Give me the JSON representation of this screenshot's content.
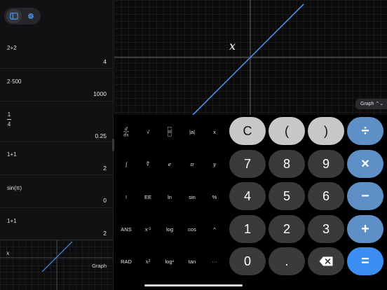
{
  "sidebar": {
    "history": [
      {
        "expr": "2+2",
        "result": "4"
      },
      {
        "expr": "2·500",
        "result": "1000"
      },
      {
        "num": "1",
        "den": "4",
        "result": "0.25"
      },
      {
        "expr": "1+1",
        "result": "2"
      },
      {
        "expr": "sin(π)",
        "result": "0"
      },
      {
        "expr": "1+1",
        "result": "2"
      }
    ],
    "mini_graph": {
      "var": "x",
      "label": "Graph"
    }
  },
  "graph": {
    "var": "x",
    "mode": "Graph ⌃⌄",
    "line_color": "#4a8fe8"
  },
  "scientific": {
    "r0": [
      "d/dx",
      "√",
      "⊡",
      "|a|",
      "x"
    ],
    "r1": [
      "∫",
      "∛",
      "e",
      "π",
      "y"
    ],
    "r2": [
      "!",
      "EE",
      "ln",
      "sin",
      "%"
    ],
    "r3": [
      "ANS",
      "x",
      "-1",
      "log",
      "cos",
      "^"
    ],
    "r4": [
      "RAD",
      "x",
      "2",
      "log",
      "a",
      "tan",
      "···"
    ]
  },
  "keypad": {
    "clear": "C",
    "paren_open": "(",
    "paren_close": ")",
    "divide": "÷",
    "seven": "7",
    "eight": "8",
    "nine": "9",
    "multiply": "×",
    "four": "4",
    "five": "5",
    "six": "6",
    "minus": "−",
    "one": "1",
    "two": "2",
    "three": "3",
    "plus": "+",
    "zero": "0",
    "dot": ".",
    "equals": "="
  }
}
